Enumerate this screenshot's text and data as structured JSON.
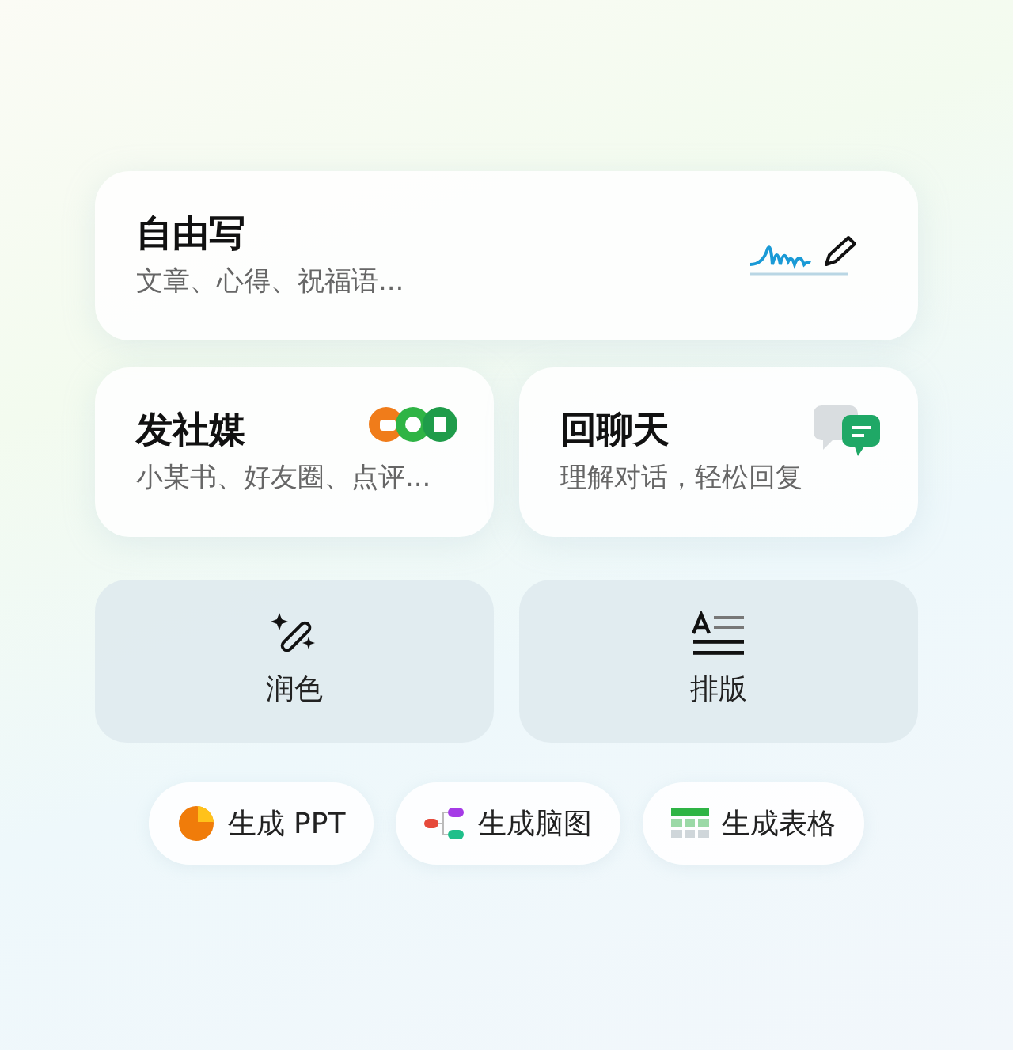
{
  "feature_cards": [
    {
      "title": "自由写",
      "subtitle": "文章、心得、祝福语...",
      "kind": "handwriting"
    },
    {
      "title": "发社媒",
      "subtitle": "小某书、好友圈、点评...",
      "kind": "social"
    },
    {
      "title": "回聊天",
      "subtitle": "理解对话，轻松回复",
      "kind": "chat"
    }
  ],
  "tools": [
    {
      "label": "润色",
      "kind": "wand"
    },
    {
      "label": "排版",
      "kind": "layout"
    }
  ],
  "chips": [
    {
      "label": "生成 PPT",
      "kind": "pie"
    },
    {
      "label": "生成脑图",
      "kind": "mindmap"
    },
    {
      "label": "生成表格",
      "kind": "table"
    }
  ]
}
